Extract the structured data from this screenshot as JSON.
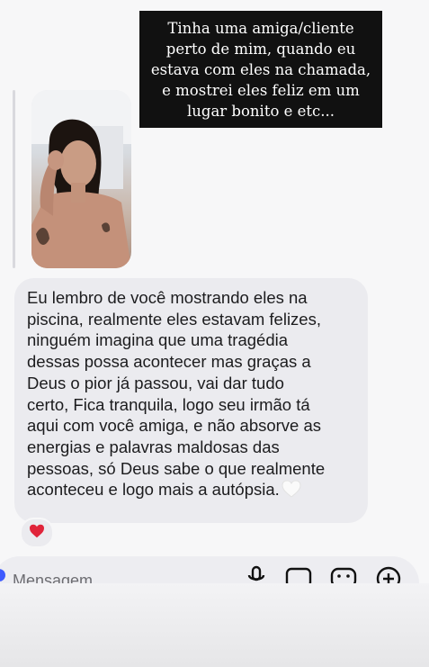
{
  "caption": {
    "lines": [
      "Tinha uma amiga/cliente",
      "perto de mim, quando eu",
      "estava com eles na chamada,",
      "e mostrei eles feliz em um",
      "lugar bonito e etc..."
    ]
  },
  "message": {
    "lines": [
      "Eu lembro de você mostrando eles na",
      "piscina, realmente eles estavam felizes,",
      "ninguém imagina que uma tragédia",
      "dessas possa acontecer mas graças a",
      "Deus o pior já passou, vai dar tudo",
      "certo, Fica tranquila, logo seu irmão tá",
      "aqui com você amiga, e não absorve as",
      "energias e palavras maldosas das",
      "pessoas, só Deus sabe o que realmente",
      "aconteceu e logo mais a autópsia."
    ],
    "trailing_emoji": "white-heart-icon",
    "reaction": "red-heart-icon"
  },
  "composer": {
    "placeholder": "Mensagem",
    "icons": [
      "microphone-icon",
      "gallery-icon",
      "sticker-icon",
      "add-icon"
    ]
  },
  "colors": {
    "bubble": "#ebebef",
    "caption_bg": "#111111",
    "reaction_heart": "#e0243a",
    "camera_button": "#3d5afe"
  }
}
